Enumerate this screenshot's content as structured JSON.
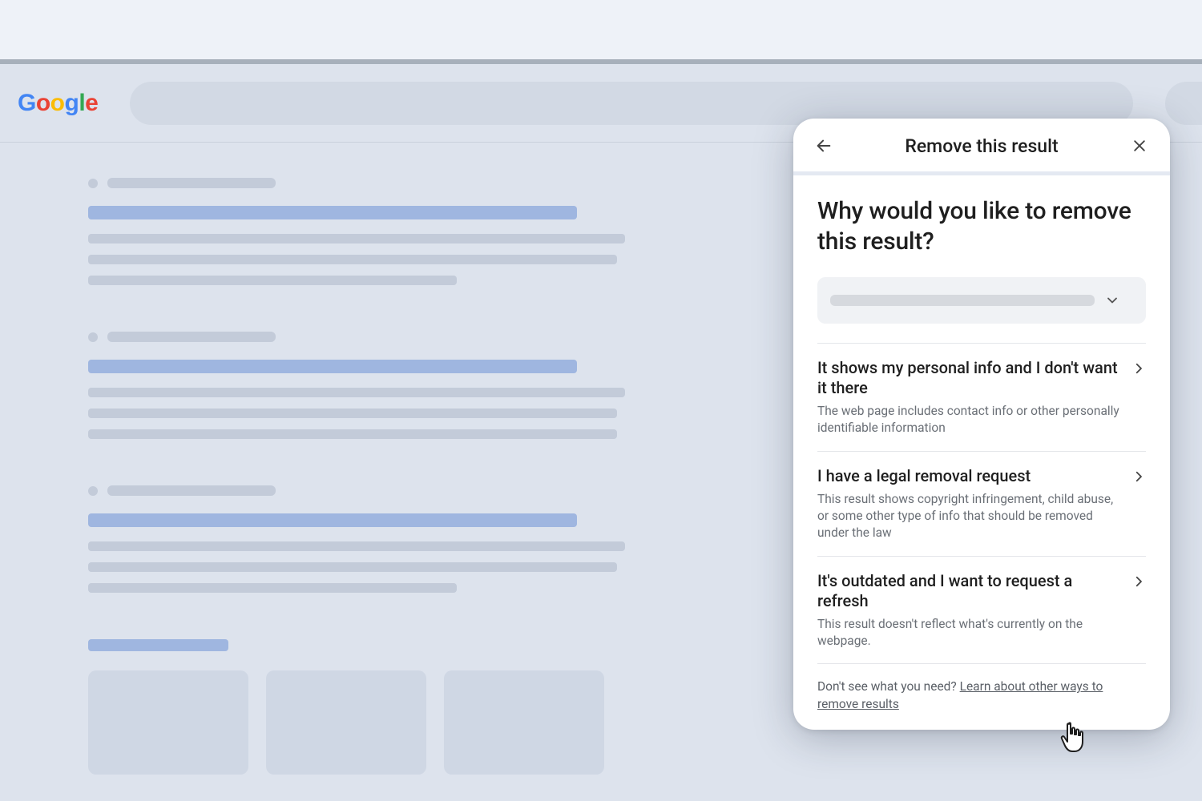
{
  "brand": {
    "name": "Google",
    "letters": [
      "G",
      "o",
      "o",
      "g",
      "l",
      "e"
    ],
    "colors": [
      "#4285F4",
      "#EA4335",
      "#FBBC05",
      "#4285F4",
      "#34A853",
      "#EA4335"
    ]
  },
  "dialog": {
    "title": "Remove this result",
    "question": "Why would you like to remove this result?",
    "options": [
      {
        "title": "It shows my personal info and I don't want it there",
        "desc": "The web page includes contact info or other personally identifiable information"
      },
      {
        "title": "I have a legal removal request",
        "desc": "This result shows copyright infringement, child abuse, or some other type of info that should be removed under the law"
      },
      {
        "title": "It's outdated and I want to request a refresh",
        "desc": "This result doesn't reflect what's currently on the webpage."
      }
    ],
    "footer_prefix": "Don't see what you need? ",
    "footer_link": "Learn about other ways to remove results"
  }
}
